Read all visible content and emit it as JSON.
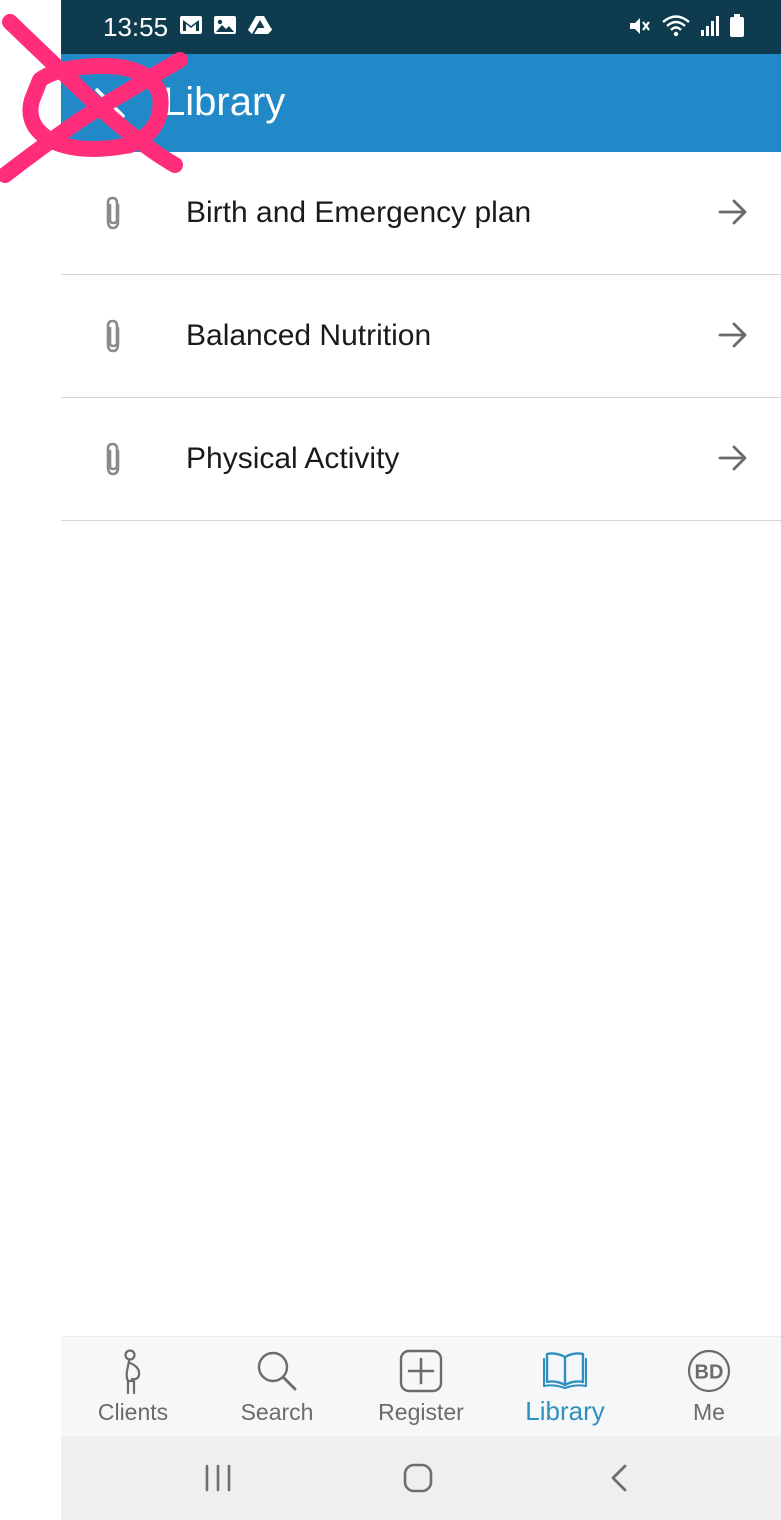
{
  "status_bar": {
    "time": "13:55",
    "left_icons": [
      "gmail-icon",
      "gallery-icon",
      "drive-icon"
    ],
    "right_icons": [
      "mute-icon",
      "wifi-icon",
      "signal-icon",
      "battery-icon"
    ]
  },
  "app_bar": {
    "title": "Library",
    "close_icon": "close-icon",
    "color": "#2189c8"
  },
  "list": {
    "items": [
      {
        "label": "Birth and Emergency plan",
        "icon": "paperclip-icon",
        "action_icon": "arrow-right-icon"
      },
      {
        "label": "Balanced Nutrition",
        "icon": "paperclip-icon",
        "action_icon": "arrow-right-icon"
      },
      {
        "label": "Physical Activity",
        "icon": "paperclip-icon",
        "action_icon": "arrow-right-icon"
      }
    ]
  },
  "bottom_nav": {
    "items": [
      {
        "label": "Clients",
        "icon": "pregnant-person-icon",
        "active": false
      },
      {
        "label": "Search",
        "icon": "search-icon",
        "active": false
      },
      {
        "label": "Register",
        "icon": "add-box-icon",
        "active": false
      },
      {
        "label": "Library",
        "icon": "book-icon",
        "active": true
      },
      {
        "label": "Me",
        "icon": "avatar-initials-icon",
        "initials": "BD",
        "active": false
      }
    ],
    "active_color": "#2f8fbf"
  },
  "system_nav": {
    "buttons": [
      "recents-icon",
      "home-icon",
      "back-icon"
    ]
  },
  "annotation": {
    "type": "crossed-circle-marker",
    "color": "#ff2d7a"
  }
}
